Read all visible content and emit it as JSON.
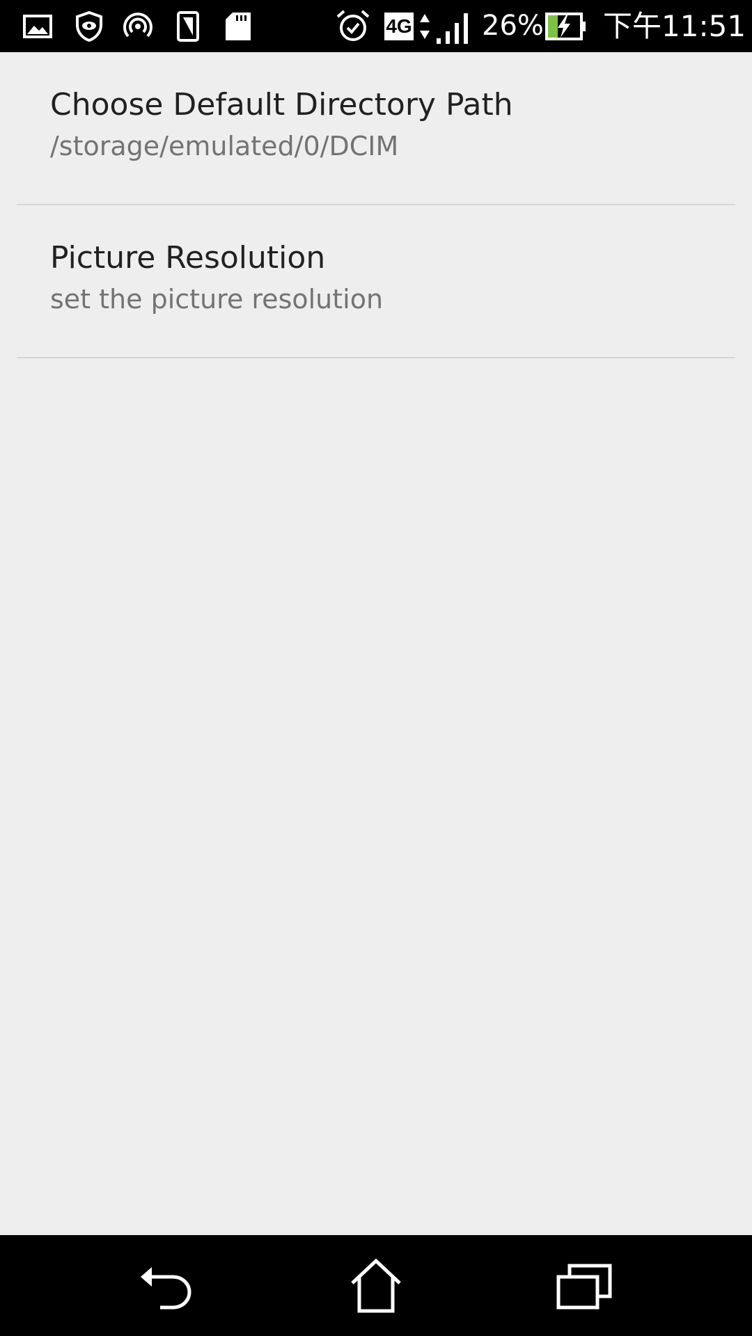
{
  "status_bar": {
    "left_icons": [
      "gallery-icon",
      "shield-eye-icon",
      "hotspot-icon",
      "sim-card-icon",
      "sd-card-icon"
    ],
    "alarm_icon": "alarm-icon",
    "network_type": "4G",
    "signal_icon": "signal-icon",
    "battery_percent": "26%",
    "battery_icon": "battery-charging-icon",
    "time": "下午11:51"
  },
  "preferences": [
    {
      "title": "Choose Default Directory Path",
      "summary": "/storage/emulated/0/DCIM"
    },
    {
      "title": "Picture Resolution",
      "summary": "set the picture resolution"
    }
  ],
  "nav_bar": {
    "back_icon": "back-icon",
    "home_icon": "home-icon",
    "recents_icon": "recents-icon"
  },
  "colors": {
    "background": "#eeeeee",
    "title_text": "#212121",
    "summary_text": "#737373",
    "divider": "#d6d6d6",
    "battery_fill": "#7cc242"
  }
}
